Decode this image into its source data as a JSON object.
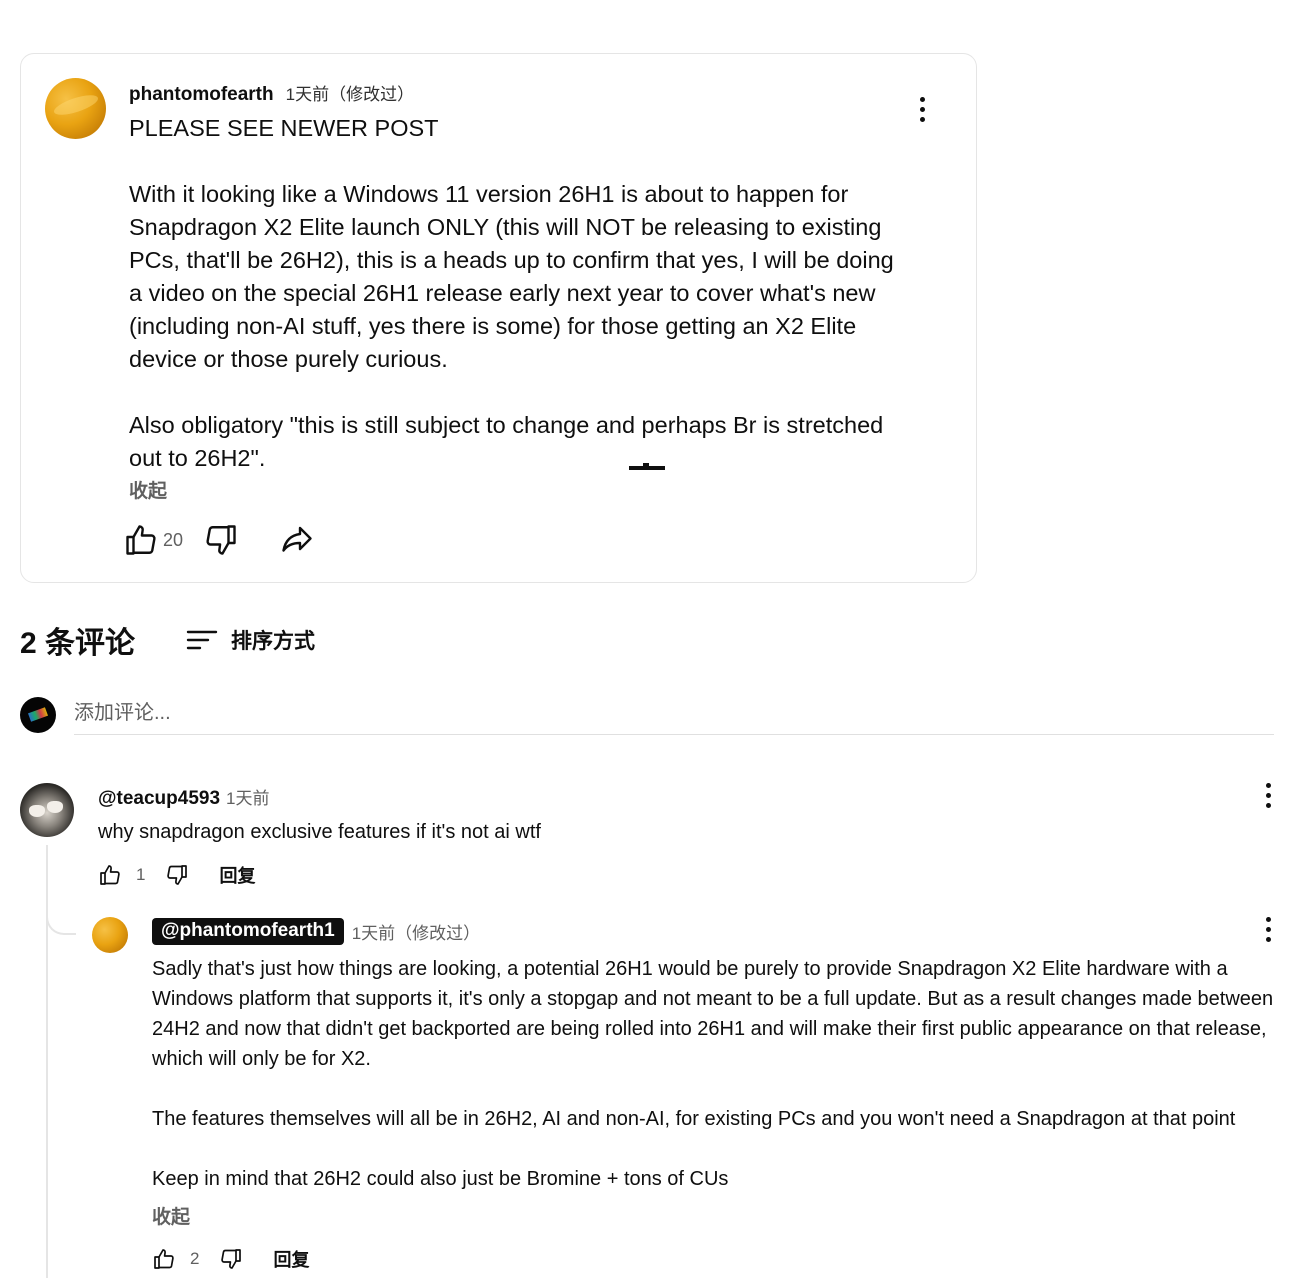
{
  "post": {
    "author": "phantomofearth",
    "time": "1天前（修改过）",
    "body": "PLEASE SEE NEWER POST\n\nWith it looking like a Windows 11 version 26H1 is about to happen for Snapdragon X2 Elite launch ONLY (this will NOT be releasing to existing PCs, that'll be 26H2), this is a heads up to confirm that yes, I will be doing a video on the special 26H1 release early next year to cover what's new (including non-AI stuff, yes there is some) for those getting an X2 Elite device or those purely curious.\n\nAlso obligatory \"this is still subject to change and perhaps Br is stretched out to 26H2\".",
    "collapse_label": "收起",
    "like_count": "20",
    "icons": [
      "thumb-up-icon",
      "thumb-down-icon",
      "share-icon",
      "more-vert-icon"
    ]
  },
  "comments_section": {
    "count_label": "2 条评论",
    "sort_label": "排序方式",
    "add_comment_placeholder": "添加评论..."
  },
  "comments": [
    {
      "author": "@teacup4593",
      "time": "1天前",
      "text": "why snapdragon exclusive features if it's not ai wtf",
      "like_count": "1",
      "reply_label": "回复",
      "replies": [
        {
          "author": "@phantomofearth1",
          "time": "1天前（修改过）",
          "text": "Sadly that's just how things are looking, a potential 26H1 would be purely to provide Snapdragon X2 Elite hardware with a Windows platform that supports it, it's only a stopgap and not meant to be a full update. But as a result changes made between 24H2 and now that didn't get backported are being rolled into 26H1 and will make their first public appearance on that release, which will only be for X2.\n\nThe features themselves will all be in 26H2, AI and non-AI, for existing PCs and you won't need a Snapdragon at that point\n\nKeep in mind that 26H2 could also just be Bromine + tons of CUs",
          "collapse_label": "收起",
          "like_count": "2",
          "reply_label": "回复"
        }
      ]
    }
  ]
}
